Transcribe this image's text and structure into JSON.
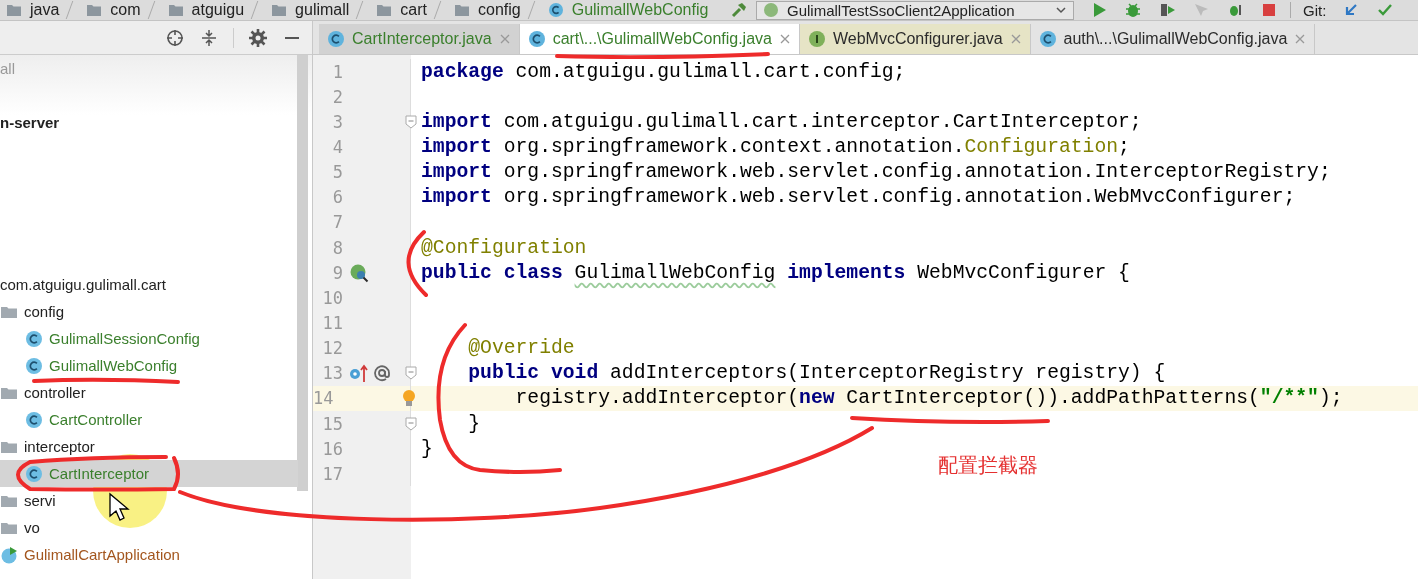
{
  "breadcrumbs": [
    {
      "label": "java",
      "kind": "folder"
    },
    {
      "label": "com",
      "kind": "folder"
    },
    {
      "label": "atguigu",
      "kind": "folder"
    },
    {
      "label": "gulimall",
      "kind": "folder"
    },
    {
      "label": "cart",
      "kind": "folder"
    },
    {
      "label": "config",
      "kind": "folder"
    },
    {
      "label": "GulimallWebConfig",
      "kind": "class"
    }
  ],
  "run_config": {
    "label": "GulimallTestSsoClient2Application"
  },
  "vcs": {
    "label": "Git:"
  },
  "tabs": [
    {
      "label": "CartInterceptor.java",
      "kind": "class",
      "color": "#3a7f2c",
      "selected": false,
      "library": false
    },
    {
      "label": "cart\\...\\GulimallWebConfig.java",
      "kind": "class",
      "color": "#3a7f2c",
      "selected": true,
      "library": false
    },
    {
      "label": "WebMvcConfigurer.java",
      "kind": "interface",
      "color": "#2b2b2b",
      "selected": false,
      "library": true
    },
    {
      "label": "auth\\...\\GulimallWebConfig.java",
      "kind": "class",
      "color": "#2b2b2b",
      "selected": false,
      "library": false
    }
  ],
  "project_tree": [
    {
      "label": "all",
      "kind": "dim",
      "selected": false
    },
    {
      "label": "n-server",
      "kind": "module",
      "selected": false
    },
    {
      "label": "com.atguigu.gulimall.cart",
      "kind": "package",
      "selected": false,
      "children": [
        {
          "label": "config",
          "kind": "folder",
          "selected": false,
          "children": [
            {
              "label": "GulimallSessionConfig",
              "kind": "class",
              "selected": false
            },
            {
              "label": "GulimallWebConfig",
              "kind": "class",
              "selected": false
            }
          ]
        },
        {
          "label": "controller",
          "kind": "folder",
          "selected": false,
          "children": [
            {
              "label": "CartController",
              "kind": "class",
              "selected": false
            }
          ]
        },
        {
          "label": "interceptor",
          "kind": "folder",
          "selected": false,
          "children": [
            {
              "label": "CartInterceptor",
              "kind": "class",
              "selected": true
            }
          ]
        },
        {
          "label": "servi",
          "kind": "folder",
          "selected": false
        },
        {
          "label": "vo",
          "kind": "folder",
          "selected": false
        },
        {
          "label": "GulimallCartApplication",
          "kind": "app",
          "selected": false
        }
      ]
    }
  ],
  "editor": {
    "lines": [
      {
        "number": "1",
        "tokens": [
          {
            "text": "package",
            "kind": "kw"
          },
          {
            "text": " com.atguigu.gulimall.cart.config;",
            "kind": "plain"
          }
        ]
      },
      {
        "number": "2"
      },
      {
        "number": "3",
        "fold": true,
        "tokens": [
          {
            "text": "import",
            "kind": "kw"
          },
          {
            "text": " com.atguigu.gulimall.cart.interceptor.CartInterceptor;",
            "kind": "plain"
          }
        ]
      },
      {
        "number": "4",
        "tokens": [
          {
            "text": "import",
            "kind": "kw"
          },
          {
            "text": " org.springframework.context.annotation.",
            "kind": "plain"
          },
          {
            "text": "Configuration",
            "kind": "ann"
          },
          {
            "text": ";",
            "kind": "plain"
          }
        ]
      },
      {
        "number": "5",
        "tokens": [
          {
            "text": "import",
            "kind": "kw"
          },
          {
            "text": " org.springframework.web.servlet.config.annotation.InterceptorRegistry;",
            "kind": "plain"
          }
        ]
      },
      {
        "number": "6",
        "tokens": [
          {
            "text": "import",
            "kind": "kw"
          },
          {
            "text": " org.springframework.web.servlet.config.annotation.WebMvcConfigurer;",
            "kind": "plain"
          }
        ]
      },
      {
        "number": "7"
      },
      {
        "number": "8",
        "tokens": [
          {
            "text": "@Configuration",
            "kind": "ann"
          }
        ]
      },
      {
        "number": "9",
        "markers": [
          {
            "kind": "bean"
          }
        ],
        "tokens": [
          {
            "text": "public class ",
            "kind": "kw"
          },
          {
            "text": "GulimallWebConfig",
            "kind": "weak"
          },
          {
            "text": " implements",
            "kind": "kw"
          },
          {
            "text": " WebMvcConfigurer {",
            "kind": "plain"
          }
        ]
      },
      {
        "number": "10"
      },
      {
        "number": "11"
      },
      {
        "number": "12",
        "tokens": [
          {
            "text": "    @Override",
            "kind": "ann"
          }
        ]
      },
      {
        "number": "13",
        "fold": true,
        "markers": [
          {
            "kind": "override"
          },
          {
            "kind": "at"
          }
        ],
        "tokens": [
          {
            "text": "    public void",
            "kind": "kw"
          },
          {
            "text": " addInterceptors(InterceptorRegistry registry) {",
            "kind": "plain"
          }
        ]
      },
      {
        "number": "14",
        "current": true,
        "markers": [
          {
            "kind": "bulb"
          }
        ],
        "tokens": [
          {
            "text": "        registry.addInterceptor(",
            "kind": "plain"
          },
          {
            "text": "new",
            "kind": "kw"
          },
          {
            "text": " CartInterceptor()).addPathPatterns(",
            "kind": "plain"
          },
          {
            "text": "\"/**\"",
            "kind": "str"
          },
          {
            "text": ");",
            "kind": "plain"
          }
        ]
      },
      {
        "number": "15",
        "fold": true,
        "tokens": [
          {
            "text": "    }",
            "kind": "plain"
          }
        ]
      },
      {
        "number": "16",
        "tokens": [
          {
            "text": "}",
            "kind": "plain"
          }
        ]
      },
      {
        "number": "17"
      }
    ]
  },
  "note": "配置拦截器"
}
